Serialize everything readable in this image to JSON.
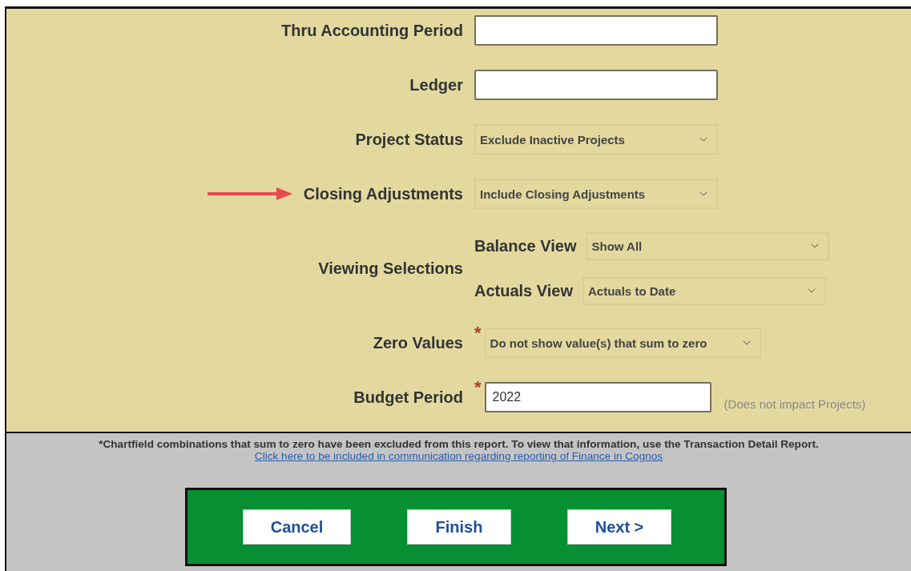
{
  "form": {
    "fields": [
      {
        "kind": "text",
        "label": "Thru Accounting Period"
      },
      {
        "kind": "text",
        "label": "Ledger"
      },
      {
        "kind": "select",
        "label": "Project Status",
        "value": "Exclude Inactive Projects"
      },
      {
        "kind": "select",
        "label": "Closing Adjustments",
        "value": "Include Closing Adjustments",
        "arrow": true
      },
      {
        "kind": "group",
        "label": "Viewing Selections",
        "children": [
          {
            "kind": "select",
            "label": "Balance View",
            "value": "Show All"
          },
          {
            "kind": "select",
            "label": "Actuals View",
            "value": "Actuals to Date"
          }
        ]
      },
      {
        "kind": "select",
        "label": "Zero Values",
        "value": "Do not show value(s) that sum to zero",
        "required_mark": "*"
      },
      {
        "kind": "text",
        "label": "Budget Period",
        "value": "2022",
        "required_mark": "*",
        "note": "(Does not impact Projects)"
      }
    ]
  },
  "footer": {
    "notice": "*Chartfield combinations that sum to zero have been excluded from this report. To view that information, use the Transaction Detail Report.",
    "link": "Click here to be included in communication regarding reporting of Finance in Cognos "
  },
  "buttons": [
    "Cancel",
    "Finish",
    "Next >"
  ]
}
